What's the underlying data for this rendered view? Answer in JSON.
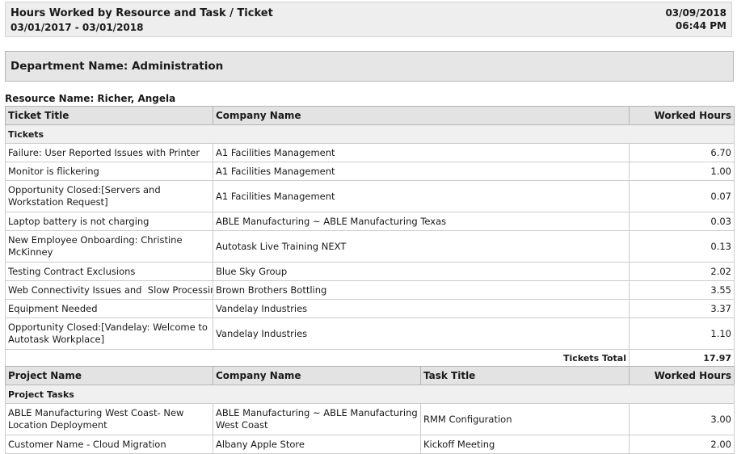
{
  "report": {
    "title": "Hours Worked by Resource and Task / Ticket",
    "date_range": "03/01/2017 - 03/01/2018",
    "run_date": "03/09/2018",
    "run_time": "06:44 PM"
  },
  "department": {
    "label": "Department Name: Administration"
  },
  "resource": {
    "label": "Resource Name: Richer, Angela"
  },
  "tickets_table": {
    "columns": [
      "Ticket Title",
      "Company Name",
      "Worked Hours"
    ],
    "section_label": "Tickets",
    "rows": [
      {
        "title": "Failure: User Reported Issues with Printer",
        "company": "A1 Facilities Management",
        "hours": "6.70"
      },
      {
        "title": "Monitor is flickering",
        "company": "A1 Facilities Management",
        "hours": "1.00"
      },
      {
        "title": "Opportunity Closed:[Servers and Workstation Request]",
        "company": "A1 Facilities Management",
        "hours": "0.07"
      },
      {
        "title": "Laptop battery is not charging",
        "company": "ABLE Manufacturing ~ ABLE Manufacturing Texas",
        "hours": "0.03"
      },
      {
        "title": "New Employee Onboarding: Christine McKinney",
        "company": "Autotask Live Training NEXT",
        "hours": "0.13"
      },
      {
        "title": "Testing Contract Exclusions",
        "company": "Blue Sky Group",
        "hours": "2.02"
      },
      {
        "title": "Web Connectivity Issues and  Slow Processing",
        "company": "Brown Brothers Bottling",
        "hours": "3.55"
      },
      {
        "title": "Equipment Needed",
        "company": "Vandelay Industries",
        "hours": "3.37"
      },
      {
        "title": "Opportunity Closed:[Vandelay: Welcome to Autotask Workplace]",
        "company": "Vandelay Industries",
        "hours": "1.10"
      }
    ],
    "total_label": "Tickets Total",
    "total_value": "17.97"
  },
  "projects_table": {
    "columns": [
      "Project Name",
      "Company Name",
      "Task Title",
      "Worked Hours"
    ],
    "section_label": "Project Tasks",
    "rows": [
      {
        "project": "ABLE Manufacturing West Coast- New Location Deployment",
        "company": "ABLE Manufacturing ~ ABLE Manufacturing West Coast",
        "task": "RMM Configuration",
        "hours": "3.00"
      },
      {
        "project": "Customer Name - Cloud Migration",
        "company": "Albany Apple Store",
        "task": "Kickoff Meeting",
        "hours": "2.00"
      }
    ]
  }
}
